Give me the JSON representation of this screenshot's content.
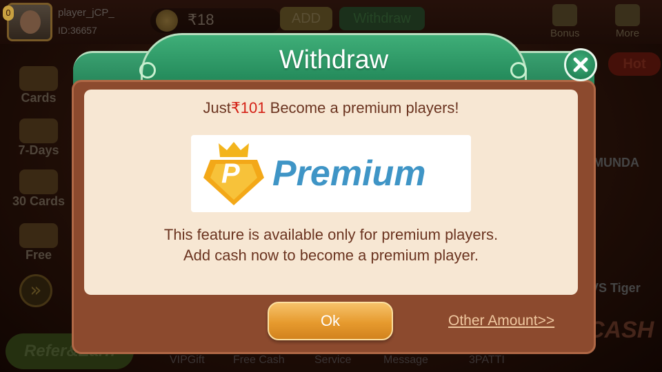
{
  "lobby": {
    "player_name": "player_jCP_",
    "player_id": "ID:36657",
    "vip_level": "0",
    "balance": "₹18",
    "add_label": "ADD",
    "withdraw_label": "Withdraw",
    "bonus_label": "Bonus",
    "more_label": "More",
    "left_menu": [
      "Cards",
      "7-Days",
      "30 Cards",
      "Free"
    ],
    "hot_label": "Hot",
    "right_labels": [
      "MUNDA",
      "VS Tiger"
    ],
    "cash_label": "CASH",
    "refer_label": "Refer&Earn",
    "bottom_nav": [
      "VIPGift",
      "Free Cash",
      "Service",
      "Message",
      "3PATTI"
    ]
  },
  "dialog": {
    "title": "Withdraw",
    "headline_prefix": "Just",
    "headline_price": "₹101",
    "headline_suffix": "Become a premium players!",
    "premium_logo_letter": "P",
    "premium_logo_text": "Premium",
    "description_line1": "This feature is available only for premium players.",
    "description_line2": "Add cash now to become a premium player.",
    "ok_label": "Ok",
    "other_amount_label": "Other Amount>>",
    "close_icon": "close-x-icon"
  },
  "colors": {
    "dialog_green": "#1f8456",
    "frame_brown": "#8c4a2e",
    "panel_cream": "#f7e7d3",
    "text_brown": "#6b3420",
    "price_red": "#d41f14",
    "premium_blue": "#3f95c6",
    "premium_gold": "#f3b41c",
    "ok_orange": "#e69a2e"
  }
}
